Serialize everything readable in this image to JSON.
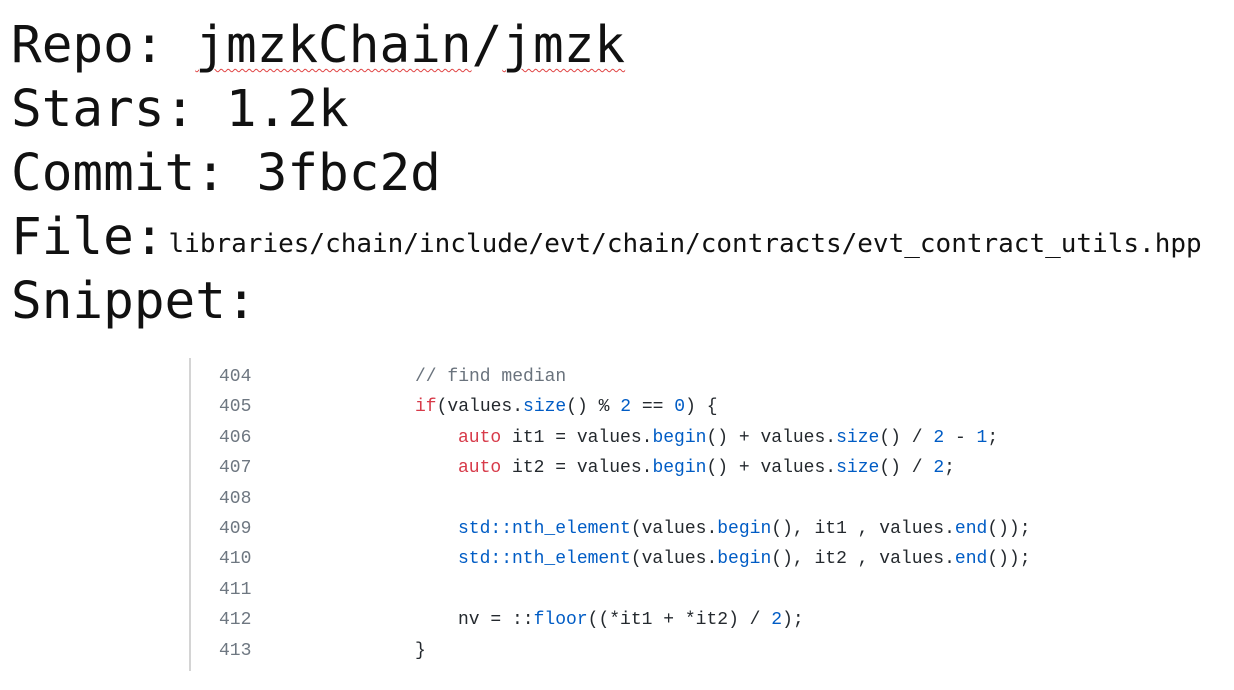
{
  "meta": {
    "repo_label": "Repo: ",
    "repo_owner": "jmzkChain",
    "repo_sep": "/",
    "repo_name": "jmzk",
    "stars_line": "Stars: 1.2k",
    "commit_line": "Commit: 3fbc2d",
    "file_label": "File:",
    "file_path": "libraries/chain/include/evt/chain/contracts/evt_contract_utils.hpp",
    "snippet_label": "Snippet:"
  },
  "code": {
    "lines": [
      {
        "n": "404",
        "indent": 0,
        "tokens": [
          {
            "t": "// find median",
            "c": "cm"
          }
        ]
      },
      {
        "n": "405",
        "indent": 0,
        "tokens": [
          {
            "t": "if",
            "c": "kw"
          },
          {
            "t": "(values.",
            "c": ""
          },
          {
            "t": "size",
            "c": "fn"
          },
          {
            "t": "() % ",
            "c": ""
          },
          {
            "t": "2",
            "c": "nm"
          },
          {
            "t": " == ",
            "c": ""
          },
          {
            "t": "0",
            "c": "nm"
          },
          {
            "t": ") {",
            "c": ""
          }
        ]
      },
      {
        "n": "406",
        "indent": 1,
        "tokens": [
          {
            "t": "auto",
            "c": "kw"
          },
          {
            "t": " it1 = values.",
            "c": ""
          },
          {
            "t": "begin",
            "c": "fn"
          },
          {
            "t": "() + values.",
            "c": ""
          },
          {
            "t": "size",
            "c": "fn"
          },
          {
            "t": "() / ",
            "c": ""
          },
          {
            "t": "2",
            "c": "nm"
          },
          {
            "t": " - ",
            "c": ""
          },
          {
            "t": "1",
            "c": "nm"
          },
          {
            "t": ";",
            "c": ""
          }
        ]
      },
      {
        "n": "407",
        "indent": 1,
        "tokens": [
          {
            "t": "auto",
            "c": "kw"
          },
          {
            "t": " it2 = values.",
            "c": ""
          },
          {
            "t": "begin",
            "c": "fn"
          },
          {
            "t": "() + values.",
            "c": ""
          },
          {
            "t": "size",
            "c": "fn"
          },
          {
            "t": "() / ",
            "c": ""
          },
          {
            "t": "2",
            "c": "nm"
          },
          {
            "t": ";",
            "c": ""
          }
        ]
      },
      {
        "n": "408",
        "indent": 0,
        "tokens": []
      },
      {
        "n": "409",
        "indent": 1,
        "tokens": [
          {
            "t": "std::nth_element",
            "c": "fn"
          },
          {
            "t": "(values.",
            "c": ""
          },
          {
            "t": "begin",
            "c": "fn"
          },
          {
            "t": "(), it1 , values.",
            "c": ""
          },
          {
            "t": "end",
            "c": "fn"
          },
          {
            "t": "());",
            "c": ""
          }
        ]
      },
      {
        "n": "410",
        "indent": 1,
        "tokens": [
          {
            "t": "std::nth_element",
            "c": "fn"
          },
          {
            "t": "(values.",
            "c": ""
          },
          {
            "t": "begin",
            "c": "fn"
          },
          {
            "t": "(), it2 , values.",
            "c": ""
          },
          {
            "t": "end",
            "c": "fn"
          },
          {
            "t": "());",
            "c": ""
          }
        ]
      },
      {
        "n": "411",
        "indent": 0,
        "tokens": []
      },
      {
        "n": "412",
        "indent": 1,
        "tokens": [
          {
            "t": "nv = ::",
            "c": ""
          },
          {
            "t": "floor",
            "c": "fn"
          },
          {
            "t": "((*it1 + *it2) / ",
            "c": ""
          },
          {
            "t": "2",
            "c": "nm"
          },
          {
            "t": ");",
            "c": ""
          }
        ]
      },
      {
        "n": "413",
        "indent": 0,
        "tokens": [
          {
            "t": "}",
            "c": ""
          }
        ]
      }
    ]
  }
}
